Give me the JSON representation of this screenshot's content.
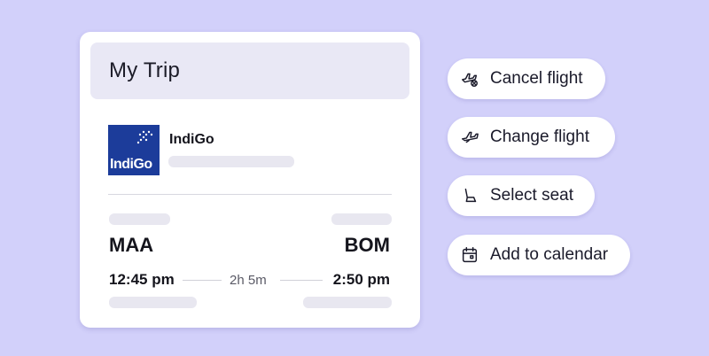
{
  "trip_card": {
    "title": "My Trip",
    "airline": {
      "name": "IndiGo",
      "logo_text": "IndiGo",
      "logo_color": "#1c3c9a"
    },
    "origin": {
      "code": "MAA",
      "time": "12:45 pm"
    },
    "destination": {
      "code": "BOM",
      "time": "2:50 pm"
    },
    "duration": "2h 5m"
  },
  "actions": [
    {
      "label": "Cancel flight",
      "icon": "cancel-flight-icon"
    },
    {
      "label": "Change flight",
      "icon": "plane-icon"
    },
    {
      "label": "Select seat",
      "icon": "seat-icon"
    },
    {
      "label": "Add to calendar",
      "icon": "calendar-icon"
    }
  ],
  "colors": {
    "background": "#d2d0fa",
    "card": "#ffffff",
    "header": "#e9e8f5",
    "skeleton": "#e8e7f0"
  }
}
